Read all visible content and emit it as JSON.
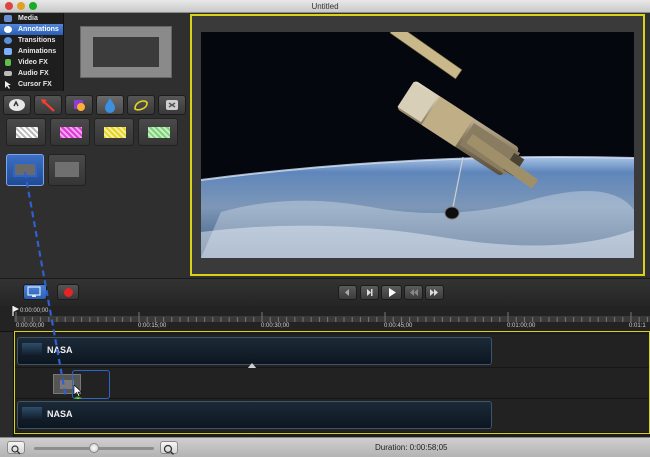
{
  "window": {
    "title": "Untitled"
  },
  "sidebar": {
    "items": [
      {
        "label": "Media",
        "icon": "media-icon",
        "color": "#6a8fd0",
        "selected": false
      },
      {
        "label": "Annotations",
        "icon": "annotations-icon",
        "color": "#ffffff",
        "selected": true
      },
      {
        "label": "Transitions",
        "icon": "transitions-icon",
        "color": "#5a8fda",
        "selected": false
      },
      {
        "label": "Animations",
        "icon": "animations-icon",
        "color": "#7ab0ff",
        "selected": false
      },
      {
        "label": "Video FX",
        "icon": "video-fx-icon",
        "color": "#5ec04c",
        "selected": false
      },
      {
        "label": "Audio FX",
        "icon": "audio-fx-icon",
        "color": "#bbbbbb",
        "selected": false
      },
      {
        "label": "Cursor FX",
        "icon": "cursor-fx-icon",
        "color": "#dddddd",
        "selected": false
      }
    ]
  },
  "annotation_tools": [
    "callout-tool-icon",
    "arrow-tool-icon",
    "shape-tool-icon",
    "highlight-tool-icon",
    "sketch-tool-icon",
    "keystroke-tool-icon"
  ],
  "style_swatches": [
    {
      "name": "white-dashed-swatch",
      "color": "#ffffff"
    },
    {
      "name": "magenta-dashed-swatch",
      "color": "#e03ad6"
    },
    {
      "name": "yellow-dashed-swatch",
      "color": "#e6d424"
    },
    {
      "name": "green-dashed-swatch",
      "color": "#7ed17a"
    }
  ],
  "timeline": {
    "playhead_time": "0:00:00;00",
    "ruler_labels": [
      "0:00:00;00",
      "0:00:15;00",
      "0:00:30;00",
      "0:00:45;00",
      "0:01:00;00",
      "0:01:1"
    ],
    "clips": [
      {
        "label": "NASA"
      },
      {
        "label": "NASA"
      }
    ]
  },
  "status": {
    "duration": "Duration: 0:00:58;05",
    "zoom": 0.5
  },
  "colors": {
    "accent_yellow": "#d9d21a",
    "selection_blue": "#2b5fb6",
    "record_red": "#e42525"
  }
}
